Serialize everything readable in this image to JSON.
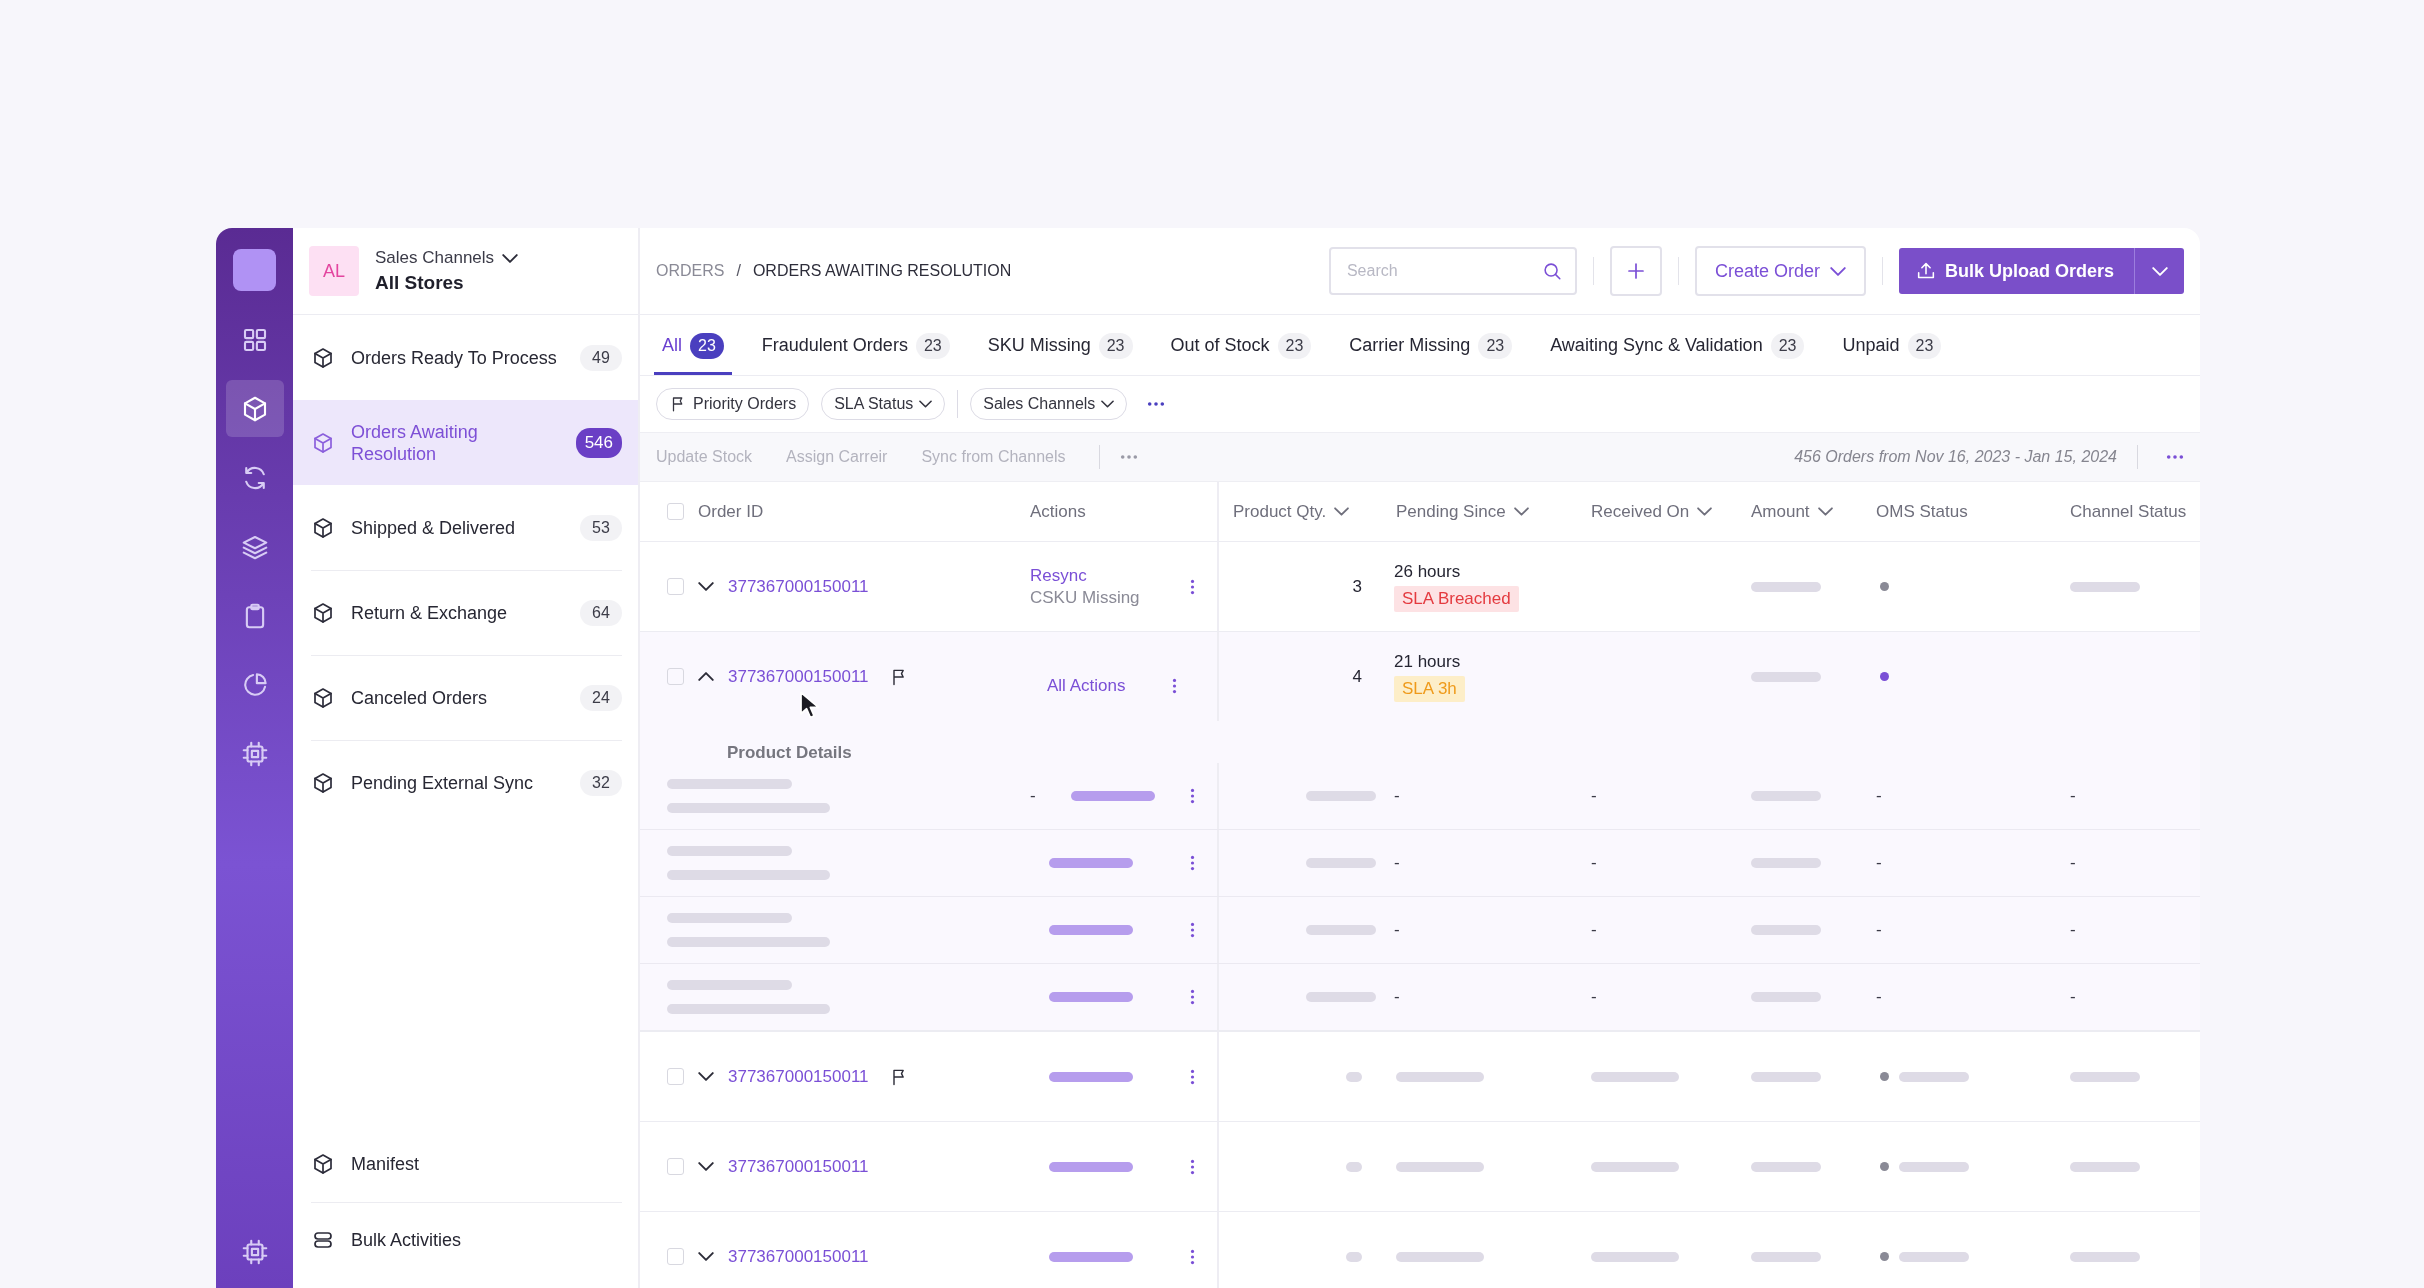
{
  "rail": {
    "items": [
      {
        "selected": false
      },
      {
        "selected": true
      },
      {
        "selected": false
      },
      {
        "selected": false
      },
      {
        "selected": false
      },
      {
        "selected": false
      },
      {
        "selected": false
      }
    ],
    "footer_item": {
      "selected": false
    }
  },
  "store_switcher": {
    "avatar": "AL",
    "label": "Sales Channels",
    "value": "All Stores"
  },
  "sidebar": {
    "items": [
      {
        "label": "Orders Ready To Process",
        "count": "49",
        "selected": false
      },
      {
        "label": "Orders Awaiting Resolution",
        "count": "546",
        "selected": true
      },
      {
        "label": "Shipped & Delivered",
        "count": "53",
        "selected": false
      },
      {
        "label": "Return & Exchange",
        "count": "64",
        "selected": false
      },
      {
        "label": "Canceled Orders",
        "count": "24",
        "selected": false
      },
      {
        "label": "Pending External Sync",
        "count": "32",
        "selected": false
      }
    ],
    "bottom_items": [
      {
        "label": "Manifest"
      },
      {
        "label": "Bulk Activities"
      }
    ]
  },
  "breadcrumb": {
    "items": [
      "ORDERS",
      "ORDERS AWAITING RESOLUTION"
    ],
    "separator": "/"
  },
  "search": {
    "placeholder": "Search"
  },
  "create_order": "Create Order",
  "bulk_upload": "Bulk Upload Orders",
  "tabs": [
    {
      "label": "All",
      "count": "23",
      "selected": true
    },
    {
      "label": "Fraudulent Orders",
      "count": "23",
      "selected": false
    },
    {
      "label": "SKU Missing",
      "count": "23",
      "selected": false
    },
    {
      "label": "Out of Stock",
      "count": "23",
      "selected": false
    },
    {
      "label": "Carrier Missing",
      "count": "23",
      "selected": false
    },
    {
      "label": "Awaiting Sync & Validation",
      "count": "23",
      "selected": false
    },
    {
      "label": "Unpaid",
      "count": "23",
      "selected": false
    }
  ],
  "filters": [
    {
      "label": "Priority Orders",
      "kind": "flag"
    },
    {
      "label": "SLA Status",
      "kind": "dropdown"
    },
    {
      "label": "Sales Channels",
      "kind": "dropdown"
    }
  ],
  "bulk_actions": {
    "actions": [
      {
        "label": "Update Stock",
        "disabled": true
      },
      {
        "label": "Assign Carreir",
        "disabled": true
      },
      {
        "label": "Sync from Channels",
        "disabled": true
      }
    ],
    "summary": "456 Orders from Nov 16, 2023 - Jan 15, 2024"
  },
  "table": {
    "select_all": false,
    "columns": [
      {
        "label": "Order ID",
        "sortable": false
      },
      {
        "label": "Actions",
        "sortable": false
      },
      {
        "label": "Product Qty.",
        "sortable": true
      },
      {
        "label": "Pending Since",
        "sortable": true
      },
      {
        "label": "Received On",
        "sortable": true
      },
      {
        "label": "Amount",
        "sortable": true
      },
      {
        "label": "OMS Status",
        "sortable": false
      },
      {
        "label": "Channel Status",
        "sortable": false
      }
    ],
    "rows": [
      {
        "kind": "order",
        "order_id": "377367000150011",
        "checked": false,
        "expanded": false,
        "flagged": false,
        "action_link": "Resync",
        "action_note": "CSKU Missing",
        "qty": "3",
        "pending": "26 hours",
        "sla": {
          "label": "SLA Breached",
          "kind": "breached"
        },
        "color": "#8a8a96"
      },
      {
        "kind": "order",
        "order_id": "377367000150011",
        "checked": false,
        "expanded": true,
        "flagged": true,
        "action_link": "All Actions",
        "qty": "4",
        "pending": "21 hours",
        "sla": {
          "label": "SLA 3h",
          "kind": "warning"
        },
        "color": "#7a4fd6",
        "details": {
          "title": "Product Details",
          "items": [
            {
              "action": "-",
              "pending": "-",
              "received": "-",
              "oms": "-",
              "channel": "-"
            },
            {
              "pending": "-",
              "received": "-",
              "oms": "-",
              "channel": "-"
            },
            {
              "pending": "-",
              "received": "-",
              "oms": "-",
              "channel": "-"
            },
            {
              "pending": "-",
              "received": "-",
              "oms": "-",
              "channel": "-"
            }
          ]
        }
      },
      {
        "kind": "loading",
        "order_id": "377367000150011",
        "checked": false,
        "expanded": false,
        "flagged": true
      },
      {
        "kind": "loading",
        "order_id": "377367000150011",
        "checked": false,
        "expanded": false,
        "flagged": false
      },
      {
        "kind": "loading",
        "order_id": "377367000150011",
        "checked": false,
        "expanded": false,
        "flagged": false
      }
    ]
  }
}
